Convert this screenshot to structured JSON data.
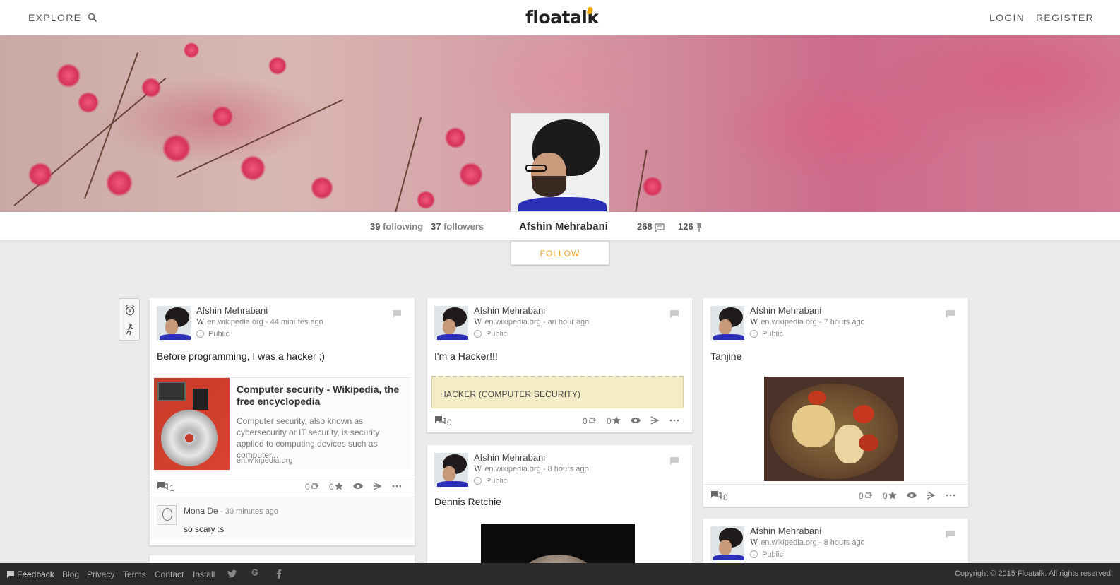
{
  "nav": {
    "explore": "EXPLORE",
    "logo": "floatalk",
    "login": "LOGIN",
    "register": "REGISTER"
  },
  "profile": {
    "name": "Afshin Mehrabani",
    "following_count": "39",
    "following_label": "following",
    "followers_count": "37",
    "followers_label": "followers",
    "posts_count": "268",
    "pins_count": "126",
    "follow_label": "FOLLOW"
  },
  "posts": [
    {
      "author": "Afshin Mehrabani",
      "source": "en.wikipedia.org - 44 minutes ago",
      "visibility": "Public",
      "text": "Before programming, I was a hacker ;)",
      "link": {
        "title": "Computer security - Wikipedia, the free encyclopedia",
        "description": "Computer security, also known as cybersecurity or IT security, is security applied to computing devices such as computer...",
        "url": "en.wikipedia.org"
      },
      "comments": "1",
      "reshares": "0",
      "stars": "0",
      "comment": {
        "author": "Mona De",
        "time": "- 30 minutes ago",
        "text": "so scary :s"
      }
    },
    {
      "author": "Afshin Mehrabani",
      "source": "en.wikipedia.org - an hour ago",
      "visibility": "Public",
      "text": "I'm a Hacker!!!",
      "box": "HACKER (COMPUTER SECURITY)",
      "comments": "0",
      "reshares": "0",
      "stars": "0"
    },
    {
      "author": "Afshin Mehrabani",
      "source": "en.wikipedia.org - 8 hours ago",
      "visibility": "Public",
      "text": "Dennis Retchie"
    },
    {
      "author": "Afshin Mehrabani",
      "source": "en.wikipedia.org - 7 hours ago",
      "visibility": "Public",
      "text": "Tanjine",
      "comments": "0",
      "reshares": "0",
      "stars": "0"
    },
    {
      "author": "Afshin Mehrabani",
      "source": "en.wikipedia.org - 8 hours ago",
      "visibility": "Public"
    }
  ],
  "footer": {
    "feedback": "Feedback",
    "blog": "Blog",
    "privacy": "Privacy",
    "terms": "Terms",
    "contact": "Contact",
    "install": "Install",
    "copyright": "Copyright © 2015 Floatalk. All rights reserved."
  },
  "colors": {
    "accent": "#f0a020",
    "footer_bg": "#2b2b2b",
    "page_bg": "#eaeaea"
  },
  "icons": [
    "search-icon",
    "comment-icon",
    "pin-icon",
    "alarm-icon",
    "walk-icon",
    "globe-icon",
    "reshare-icon",
    "star-icon",
    "eye-icon",
    "share-icon",
    "more-icon",
    "twitter-icon",
    "google-icon",
    "facebook-icon"
  ]
}
